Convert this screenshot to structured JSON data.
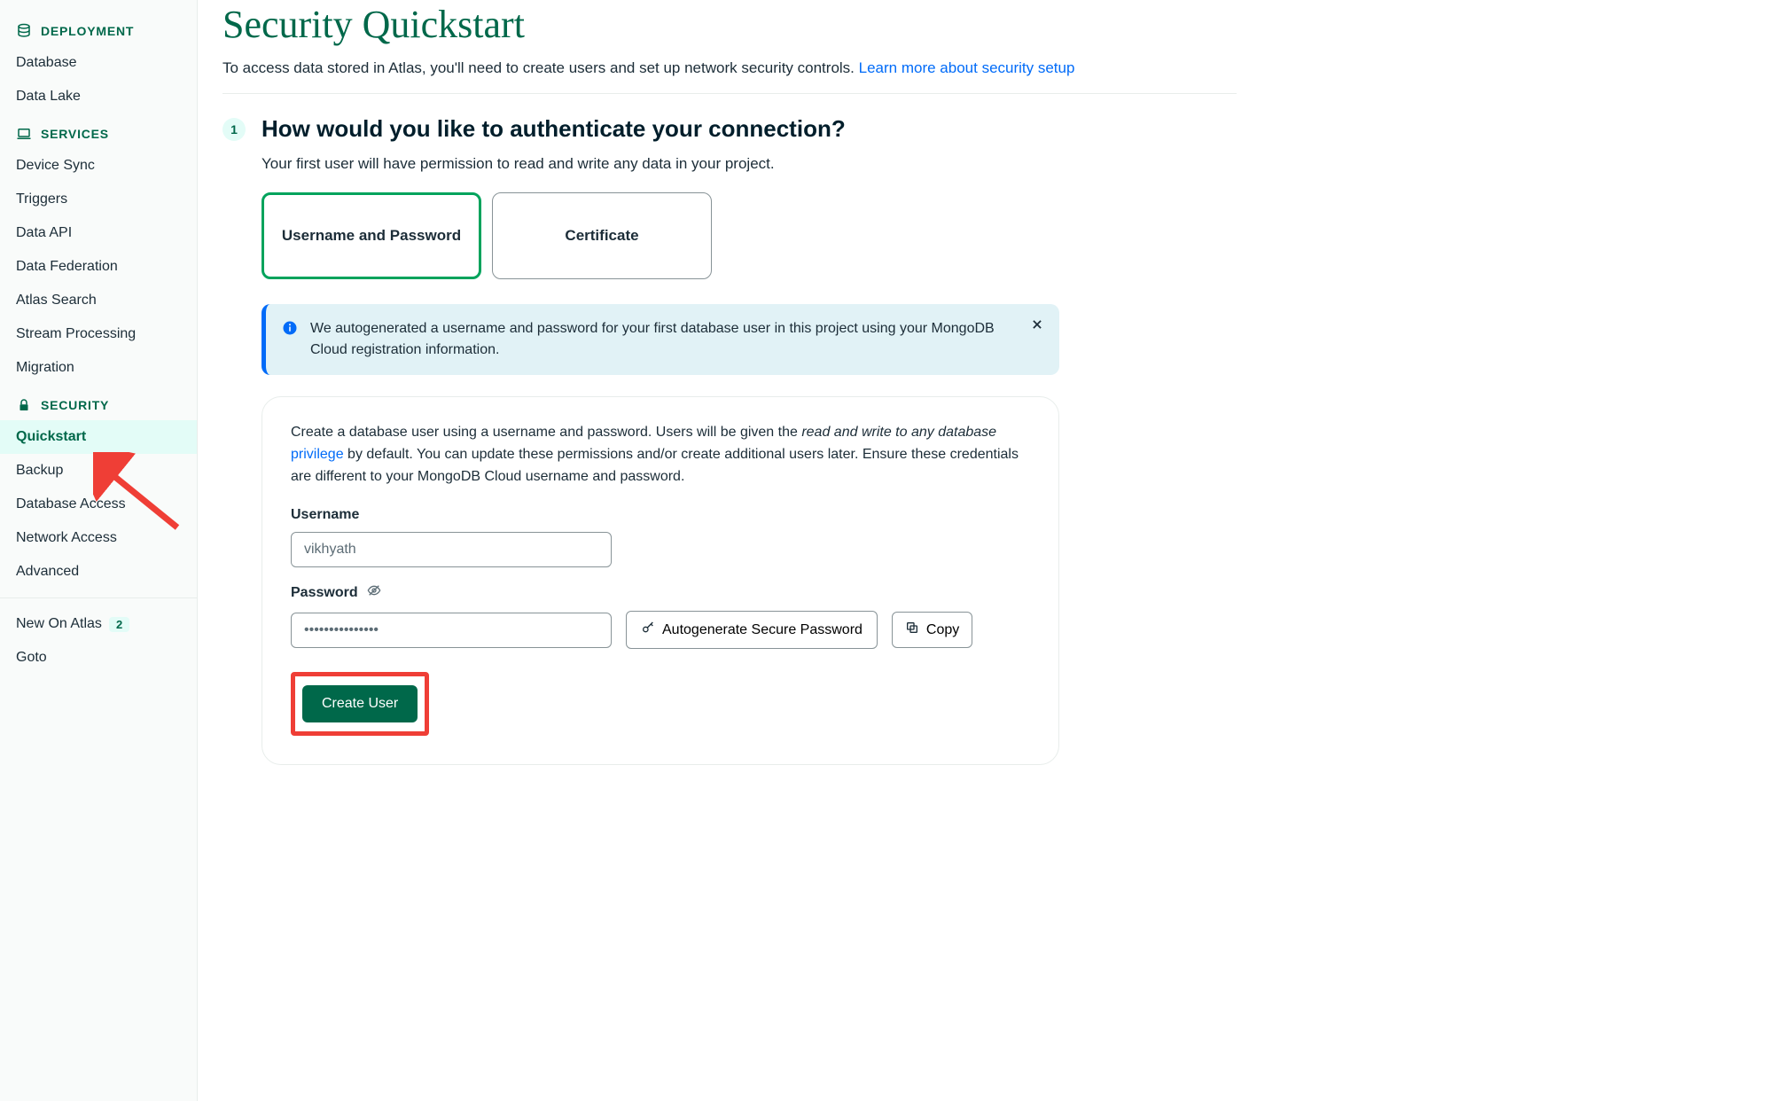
{
  "sidebar": {
    "sections": [
      {
        "label": "DEPLOYMENT",
        "icon": "database-icon"
      },
      {
        "label": "SERVICES",
        "icon": "laptop-icon"
      },
      {
        "label": "SECURITY",
        "icon": "lock-icon"
      }
    ],
    "deployment": {
      "items": [
        "Database",
        "Data Lake"
      ]
    },
    "services": {
      "items": [
        "Device Sync",
        "Triggers",
        "Data API",
        "Data Federation",
        "Atlas Search",
        "Stream Processing",
        "Migration"
      ]
    },
    "security": {
      "items": [
        "Quickstart",
        "Backup",
        "Database Access",
        "Network Access",
        "Advanced"
      ],
      "active": "Quickstart"
    },
    "footer": {
      "new_on_atlas": {
        "label": "New On Atlas",
        "badge": "2"
      },
      "goto": {
        "label": "Goto"
      }
    }
  },
  "main": {
    "title": "Security Quickstart",
    "subtitle": {
      "text": "To access data stored in Atlas, you'll need to create users and set up network security controls.",
      "link_text": "Learn more about security setup"
    },
    "step": {
      "number": "1",
      "title": "How would you like to authenticate your connection?",
      "desc": "Your first user will have permission to read and write any data in your project.",
      "options": [
        "Username and Password",
        "Certificate"
      ],
      "selected": "Username and Password"
    },
    "banner": {
      "text": "We autogenerated a username and password for your first database user in this project using your MongoDB Cloud registration information."
    },
    "form": {
      "desc_prefix": "Create a database user using a username and password. Users will be given the ",
      "desc_em": "read and write to any database ",
      "desc_link": "privilege",
      "desc_suffix": " by default. You can update these permissions and/or create additional users later. Ensure these credentials are different to your MongoDB Cloud username and password.",
      "username_label": "Username",
      "username_value": "vikhyath",
      "password_label": "Password",
      "password_value": "•••••••••••••••",
      "autogen_label": "Autogenerate Secure Password",
      "copy_label": "Copy",
      "create_label": "Create User"
    }
  }
}
